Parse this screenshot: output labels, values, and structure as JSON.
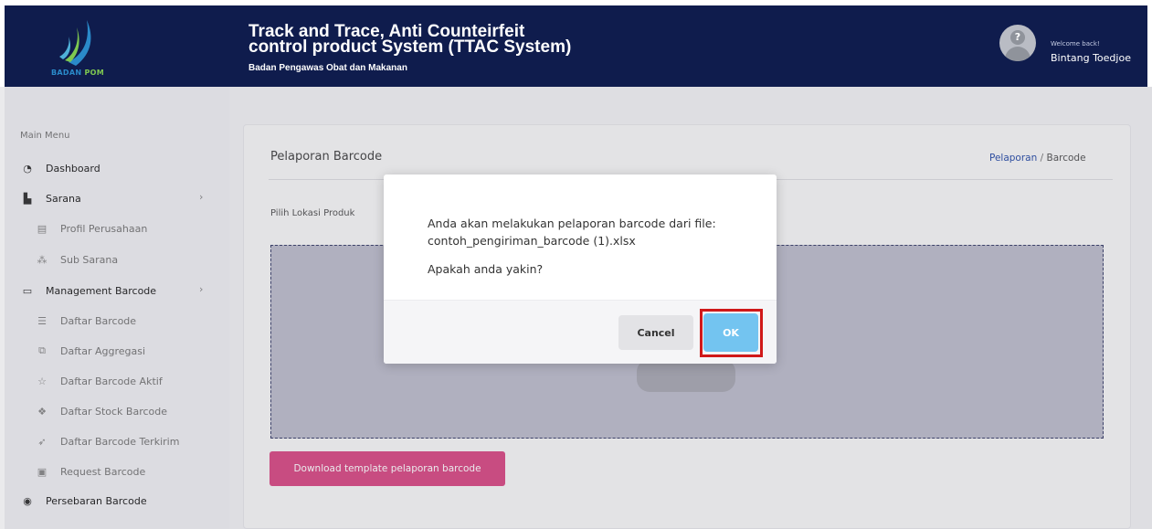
{
  "header": {
    "logo_text_1": "BADAN",
    "logo_text_2": "POM",
    "title_line1": "Track and Trace, Anti Counteirfeit",
    "title_line2": "control product System (TTAC System)",
    "subtitle": "Badan Pengawas Obat dan Makanan",
    "welcome": "Welcome back!",
    "username": "Bintang Toedjoe",
    "colors": {
      "header_bg": "#0f1c4d"
    }
  },
  "sidebar": {
    "heading": "Main Menu",
    "items": [
      {
        "label": "Dashboard",
        "icon": "dashboard-icon",
        "glyph": "◔",
        "level": "top"
      },
      {
        "label": "Sarana",
        "icon": "sarana-icon",
        "glyph": "▙",
        "level": "top",
        "chevron": "›"
      },
      {
        "label": "Profil Perusahaan",
        "icon": "building-icon",
        "glyph": "▤",
        "level": "sub"
      },
      {
        "label": "Sub Sarana",
        "icon": "network-icon",
        "glyph": "⁂",
        "level": "sub"
      },
      {
        "label": "Management Barcode",
        "icon": "calendar-icon",
        "glyph": "▭",
        "level": "top",
        "chevron": "›"
      },
      {
        "label": "Daftar Barcode",
        "icon": "list-icon",
        "glyph": "☰",
        "level": "sub"
      },
      {
        "label": "Daftar Aggregasi",
        "icon": "layers-icon",
        "glyph": "⧉",
        "level": "sub"
      },
      {
        "label": "Daftar Barcode Aktif",
        "icon": "star-icon",
        "glyph": "☆",
        "level": "sub"
      },
      {
        "label": "Daftar Stock Barcode",
        "icon": "box-icon",
        "glyph": "❖",
        "level": "sub"
      },
      {
        "label": "Daftar Barcode Terkirim",
        "icon": "send-icon",
        "glyph": "➶",
        "level": "sub"
      },
      {
        "label": "Request Barcode",
        "icon": "monitor-icon",
        "glyph": "▣",
        "level": "sub"
      },
      {
        "label": "Persebaran Barcode",
        "icon": "location-pin-icon",
        "glyph": "◉",
        "level": "top"
      }
    ]
  },
  "main": {
    "card_title": "Pelaporan Barcode",
    "breadcrumb": {
      "link": "Pelaporan",
      "separator": "/",
      "current": "Barcode"
    },
    "field_label": "Pilih Lokasi Produk",
    "download_button": "Download template pelaporan barcode",
    "colors": {
      "download_button": "#d94c86"
    }
  },
  "modal": {
    "message_line1": "Anda akan melakukan pelaporan barcode dari file:",
    "message_line2": "contoh_pengiriman_barcode (1).xlsx",
    "question": "Apakah anda yakin?",
    "cancel_label": "Cancel",
    "ok_label": "OK",
    "colors": {
      "ok_button": "#73c4f0",
      "highlight": "#d01919"
    }
  }
}
